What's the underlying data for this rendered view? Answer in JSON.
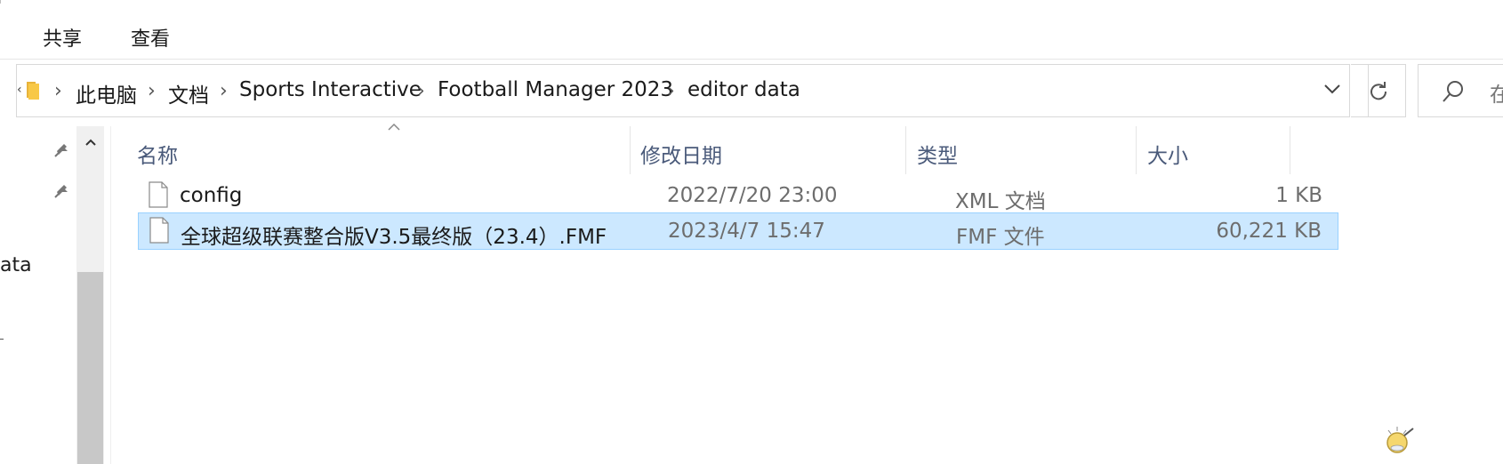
{
  "ribbon": {
    "tabs": [
      {
        "label": "共享"
      },
      {
        "label": "查看"
      }
    ]
  },
  "address_bar": {
    "breadcrumbs": [
      "此电脑",
      "文档",
      "Sports Interactive",
      "Football Manager 2023",
      "editor data"
    ],
    "icons": {
      "folder": "folder-icon",
      "dropdown": "chevron-down-icon",
      "refresh": "refresh-icon"
    }
  },
  "search": {
    "placeholder": "在"
  },
  "nav_pane": {
    "partial_items": [
      "ata"
    ],
    "icons": [
      "pin-icon",
      "pin-icon"
    ]
  },
  "file_list": {
    "columns": [
      "名称",
      "修改日期",
      "类型",
      "大小"
    ],
    "sort_column": "名称",
    "rows": [
      {
        "name": "config",
        "modified": "2022/7/20 23:00",
        "type": "XML 文档",
        "size": "1 KB",
        "selected": false
      },
      {
        "name": "全球超级联赛整合版V3.5最终版（23.4）.FMF",
        "modified": "2023/4/7 15:47",
        "type": "FMF 文件",
        "size": "60,221 KB",
        "selected": true
      }
    ]
  },
  "colors": {
    "selection_bg": "#cce8ff",
    "selection_border": "#99d1ff",
    "header_text": "#4a5a7a",
    "folder_yellow": "#f8c846"
  }
}
